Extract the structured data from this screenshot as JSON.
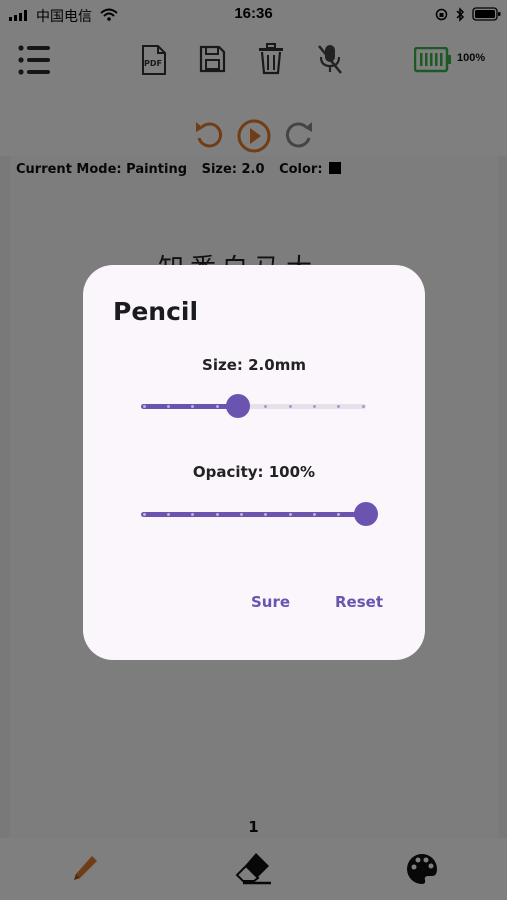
{
  "status_bar": {
    "carrier": "中国电信",
    "time": "16:36",
    "battery_percent": "100%"
  },
  "toolbar": {
    "icons": [
      "menu-icon",
      "pdf-icon",
      "save-icon",
      "trash-icon",
      "mic-off-icon"
    ],
    "pdf_label": "PDF"
  },
  "playback": {
    "icons": [
      "undo-icon",
      "play-icon",
      "redo-icon"
    ]
  },
  "canvas": {
    "mode_label": "Current Mode: Painting",
    "size_label": "Size: 2.0",
    "color_label": "Color:",
    "color_value": "#000000",
    "handwriting": "知悉白马大",
    "page_number": "1"
  },
  "bottom_nav": {
    "icons": [
      "pencil-icon",
      "eraser-icon",
      "palette-icon"
    ]
  },
  "dialog": {
    "title": "Pencil",
    "size_label": "Size: 2.0mm",
    "size_fraction": 0.43,
    "opacity_label": "Opacity: 100%",
    "opacity_fraction": 1.0,
    "sure_label": "Sure",
    "reset_label": "Reset"
  },
  "colors": {
    "accent": "#6b54b0",
    "pencil": "#e07a2e",
    "battery": "#3bb34a",
    "dialog_bg": "#fbf6fb"
  }
}
